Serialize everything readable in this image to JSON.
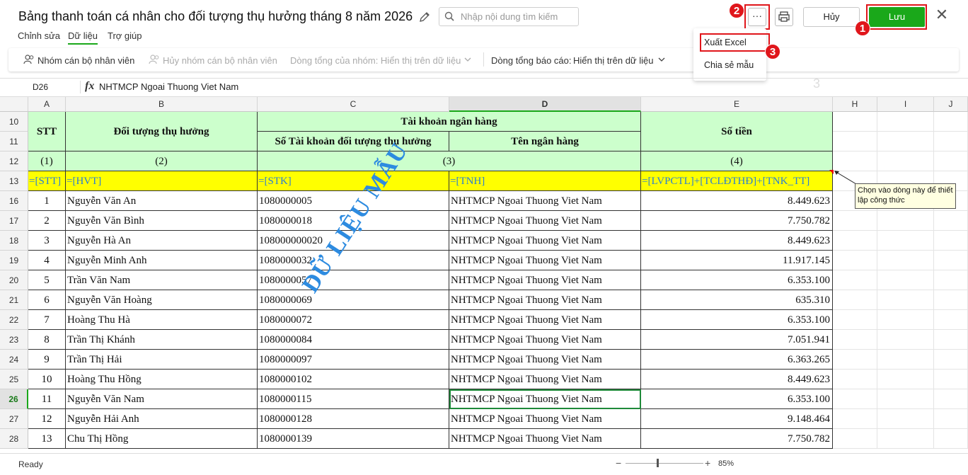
{
  "header": {
    "title": "Bảng thanh toán cá nhân cho đối tượng thụ hưởng tháng 8 năm 2026",
    "search_placeholder": "Nhập nội dung tìm kiếm",
    "more_label": "···",
    "cancel_label": "Hủy",
    "save_label": "Lưu",
    "close_label": "✕"
  },
  "callouts": {
    "one": "1",
    "two": "2",
    "three": "3"
  },
  "tabs": [
    "Chỉnh sửa",
    "Dữ liệu",
    "Trợ giúp"
  ],
  "active_tab": "Dữ liệu",
  "toolbar": {
    "group_staff": "Nhóm cán bộ nhân viên",
    "ungroup_staff": "Hủy nhóm cán bộ nhân viên",
    "group_total": "Dòng tổng của nhóm: Hiển thị trên dữ liệu",
    "report_total_label": "Dòng tổng báo cáo:",
    "report_total_value": "Hiển thị trên dữ liệu"
  },
  "menu": {
    "items": [
      "Xuất Excel",
      "Chia sẻ mẫu"
    ]
  },
  "formula_bar": {
    "cell_ref": "D26",
    "fx": "fx",
    "value": "NHTMCP Ngoai Thuong Viet Nam"
  },
  "faint_label": "3",
  "columns": [
    "A",
    "B",
    "C",
    "D",
    "E",
    "H",
    "I",
    "J"
  ],
  "header_rows": {
    "row_numbers": [
      "10",
      "11",
      "12",
      "13"
    ],
    "stt": "STT",
    "beneficiary": "Đối tượng thụ hưởng",
    "bank_account": "Tài khoản ngân hàng",
    "account_no": "Số Tài khoản đối tượng thụ hưởng",
    "bank_name": "Tên ngân hàng",
    "amount": "Số tiền",
    "idx": [
      "(1)",
      "(2)",
      "(3)",
      "(4)"
    ],
    "formulas": [
      "=[STT]",
      "=[HVT]",
      "=[STK]",
      "=[TNH]",
      "=[LVPCTL]+[TCLĐTHĐ]+[TNK_TT]"
    ]
  },
  "rows": [
    {
      "row": "16",
      "stt": "1",
      "name": "Nguyễn Văn An",
      "account": "1080000005",
      "bank": "NHTMCP Ngoai Thuong Viet Nam",
      "amount": "8.449.623"
    },
    {
      "row": "17",
      "stt": "2",
      "name": "Nguyễn Văn Bình",
      "account": "1080000018",
      "bank": "NHTMCP Ngoai Thuong Viet Nam",
      "amount": "7.750.782"
    },
    {
      "row": "18",
      "stt": "3",
      "name": "Nguyễn Hà An",
      "account": "108000000020",
      "bank": "NHTMCP Ngoai Thuong Viet Nam",
      "amount": "8.449.623"
    },
    {
      "row": "19",
      "stt": "4",
      "name": "Nguyễn Minh Anh",
      "account": "1080000032",
      "bank": "NHTMCP Ngoai Thuong Viet Nam",
      "amount": "11.917.145"
    },
    {
      "row": "20",
      "stt": "5",
      "name": "Trần Văn Nam",
      "account": "1080000057",
      "bank": "NHTMCP Ngoai Thuong Viet Nam",
      "amount": "6.353.100"
    },
    {
      "row": "21",
      "stt": "6",
      "name": "Nguyễn Văn Hoàng",
      "account": "1080000069",
      "bank": "NHTMCP Ngoai Thuong Viet Nam",
      "amount": "635.310"
    },
    {
      "row": "22",
      "stt": "7",
      "name": "Hoàng Thu Hà",
      "account": "1080000072",
      "bank": "NHTMCP Ngoai Thuong Viet Nam",
      "amount": "6.353.100"
    },
    {
      "row": "23",
      "stt": "8",
      "name": "Trần Thị Khánh",
      "account": "1080000084",
      "bank": "NHTMCP Ngoai Thuong Viet Nam",
      "amount": "7.051.941"
    },
    {
      "row": "24",
      "stt": "9",
      "name": "Trần Thị Hải",
      "account": "1080000097",
      "bank": "NHTMCP Ngoai Thuong Viet Nam",
      "amount": "6.363.265"
    },
    {
      "row": "25",
      "stt": "10",
      "name": "Hoàng Thu Hồng",
      "account": "1080000102",
      "bank": "NHTMCP Ngoai Thuong Viet Nam",
      "amount": "8.449.623"
    },
    {
      "row": "26",
      "stt": "11",
      "name": "Nguyễn Văn Nam",
      "account": "1080000115",
      "bank": "NHTMCP Ngoai Thuong Viet Nam",
      "amount": "6.353.100"
    },
    {
      "row": "27",
      "stt": "12",
      "name": "Nguyễn Hải Anh",
      "account": "1080000128",
      "bank": "NHTMCP Ngoai Thuong Viet Nam",
      "amount": "9.148.464"
    },
    {
      "row": "28",
      "stt": "13",
      "name": "Chu Thị Hồng",
      "account": "1080000139",
      "bank": "NHTMCP Ngoai Thuong Viet Nam",
      "amount": "7.750.782"
    }
  ],
  "active_row": "26",
  "watermark": "DỮ LIỆU MẪU",
  "note": "Chọn vào dòng này để thiết lập công thức",
  "status": {
    "ready": "Ready",
    "zoom": "85%"
  },
  "colors": {
    "accent": "#1aa81a",
    "header_fill": "#ccffcc",
    "formula_fill": "#ffff00",
    "callout": "#e0161b"
  }
}
